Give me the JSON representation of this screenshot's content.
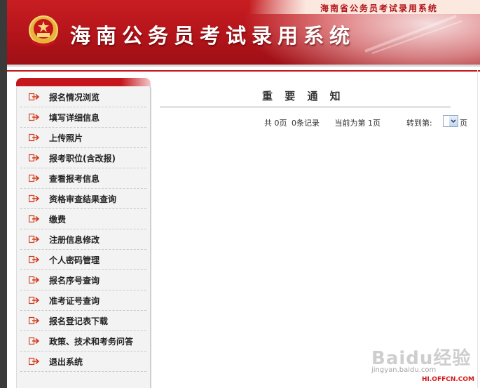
{
  "header": {
    "title": "海南公务员考试录用系统",
    "subtitle": "海南省公务员考试录用系统",
    "emblem_icon": "national-emblem-icon"
  },
  "sidebar": {
    "items": [
      {
        "label": "报名情况浏览",
        "icon": "arrow-right-icon"
      },
      {
        "label": "填写详细信息",
        "icon": "arrow-right-icon"
      },
      {
        "label": "上传照片",
        "icon": "arrow-right-icon"
      },
      {
        "label": "报考职位(含改报)",
        "icon": "arrow-right-icon"
      },
      {
        "label": "查看报考信息",
        "icon": "arrow-right-icon"
      },
      {
        "label": "资格审查结果查询",
        "icon": "arrow-right-icon"
      },
      {
        "label": "缴费",
        "icon": "arrow-right-icon"
      },
      {
        "label": "注册信息修改",
        "icon": "arrow-right-icon"
      },
      {
        "label": "个人密码管理",
        "icon": "arrow-right-icon"
      },
      {
        "label": "报名序号查询",
        "icon": "arrow-right-icon"
      },
      {
        "label": "准考证号查询",
        "icon": "arrow-right-icon"
      },
      {
        "label": "报名登记表下载",
        "icon": "arrow-right-icon"
      },
      {
        "label": "政策、技术和考务问答",
        "icon": "arrow-right-icon"
      },
      {
        "label": "退出系统",
        "icon": "arrow-right-icon"
      }
    ]
  },
  "main": {
    "title": "重 要 通 知",
    "pager": {
      "total_pages": "共 0页",
      "total_records": "0条记录",
      "current_page": "当前为第 1页",
      "goto_label": "转到第:",
      "page_unit": "页"
    }
  },
  "watermark": {
    "baidu": "Baidu经验",
    "jingyan": "jingyan.baidu.com",
    "offcn": "HI.OFFCN.COM"
  },
  "colors": {
    "brand_red": "#c4161c",
    "menu_bg": "#f3f3f3"
  }
}
